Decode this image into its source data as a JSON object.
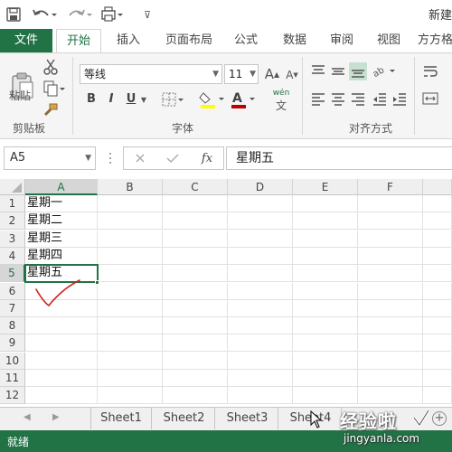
{
  "titlebar": {
    "doc_title": "新建",
    "qa_more": "⊽"
  },
  "tabs": {
    "file": "文件",
    "home": "开始",
    "insert": "插入",
    "layout": "页面布局",
    "formula": "公式",
    "data": "数据",
    "review": "审阅",
    "view": "视图",
    "extra": "方方格"
  },
  "ribbon": {
    "paste_label": "粘贴",
    "clipboard_group": "剪贴板",
    "font_name": "等线",
    "font_size": "11",
    "bold": "B",
    "italic": "I",
    "underline": "U",
    "font_group": "字体",
    "align_group": "对齐方式",
    "increase_font": "A",
    "decrease_font": "A",
    "wen": "wén"
  },
  "formulabar": {
    "name_box": "A5",
    "formula_value": "星期五",
    "fx": "fx"
  },
  "grid": {
    "columns": [
      "A",
      "B",
      "C",
      "D",
      "E",
      "F"
    ],
    "rows": [
      "1",
      "2",
      "3",
      "4",
      "5",
      "6",
      "7",
      "8",
      "9",
      "10",
      "11",
      "12"
    ],
    "cells": {
      "A1": "星期一",
      "A2": "星期二",
      "A3": "星期三",
      "A4": "星期四",
      "A5": "星期五"
    },
    "active_cell": "A5"
  },
  "sheets": {
    "tabs": [
      "Sheet1",
      "Sheet2",
      "Sheet3",
      "Sheet4"
    ],
    "add": "+"
  },
  "status": {
    "text": "就绪"
  },
  "watermark": {
    "line1": "经验啦",
    "line2": "jingyanla.com"
  },
  "colors": {
    "accent": "#217346",
    "status_bg": "#217346",
    "checkmark": "#d0211c"
  }
}
